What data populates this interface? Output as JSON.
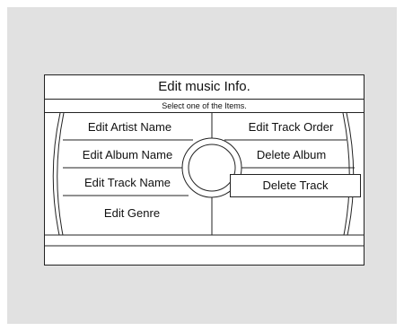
{
  "screen": {
    "title": "Edit music Info.",
    "subtitle": "Select one of the Items."
  },
  "menu": {
    "left": [
      {
        "label": "Edit Artist Name"
      },
      {
        "label": "Edit Album Name"
      },
      {
        "label": "Edit Track Name"
      },
      {
        "label": "Edit Genre"
      }
    ],
    "right": [
      {
        "label": "Edit Track Order"
      },
      {
        "label": "Delete Album"
      },
      {
        "label": "Delete Track",
        "selected": true
      }
    ]
  },
  "colors": {
    "background": "#e1e1e1",
    "screen": "#ffffff",
    "line": "#222222"
  }
}
